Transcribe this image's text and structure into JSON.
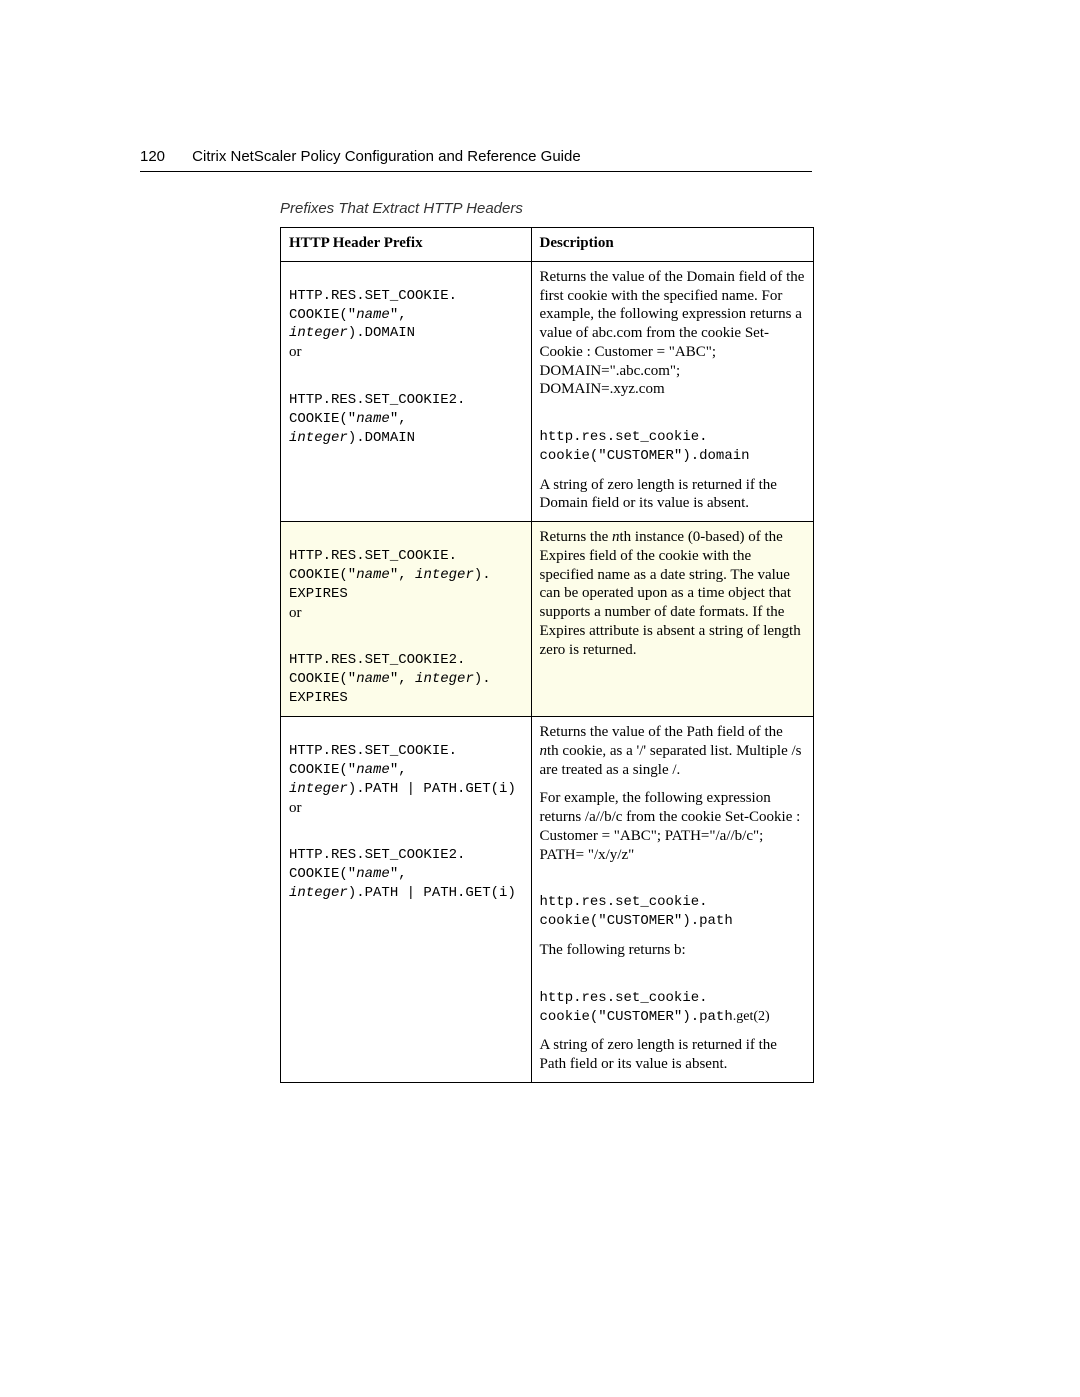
{
  "header": {
    "page_number": "120",
    "title": "Citrix NetScaler Policy Configuration and Reference Guide"
  },
  "table": {
    "caption": "Prefixes That Extract HTTP Headers",
    "headers": {
      "col1": "HTTP Header Prefix",
      "col2": "Description"
    },
    "rows": [
      {
        "prefix": {
          "l1a": "HTTP.RES.SET_COOKIE.",
          "l1b_pre": "COOKIE(\"",
          "l1b_arg1": "name",
          "l1b_mid": "\", ",
          "l1b_arg2": "integer",
          "l1b_post": ").DOMAIN",
          "or": "or",
          "l2a": "HTTP.RES.SET_COOKIE2.",
          "l2b_pre": "COOKIE(\"",
          "l2b_arg1": "name",
          "l2b_mid": "\", ",
          "l2b_arg2": "integer",
          "l2b_post": ").DOMAIN"
        },
        "desc": {
          "p1": "Returns the value of the Domain field of the first cookie with the specified name. For example, the following expression returns a value of abc.com from the cookie Set-Cookie : Customer = \"ABC\"; DOMAIN=\".abc.com\"; DOMAIN=.xyz.com",
          "code1a": "http.res.set_cookie.",
          "code1b": "cookie(\"CUSTOMER\").domain",
          "p2": "A string of zero length is returned if the Domain field or its value is absent."
        }
      },
      {
        "prefix": {
          "l1a": "HTTP.RES.SET_COOKIE.",
          "l1b_pre": "COOKIE(\"",
          "l1b_arg1": "name",
          "l1b_mid": "\", ",
          "l1b_arg2": "integer",
          "l1b_post": ").",
          "l1c": "EXPIRES",
          "or": "or",
          "l2a": "HTTP.RES.SET_COOKIE2.",
          "l2b_pre": "COOKIE(\"",
          "l2b_arg1": "name",
          "l2b_mid": "\", ",
          "l2b_arg2": "integer",
          "l2b_post": ").",
          "l2c": "EXPIRES"
        },
        "desc": {
          "p1_pre": "Returns the ",
          "p1_n": "n",
          "p1_post": "th instance (0-based) of the Expires field of the cookie with the specified name as a date string. The value can be operated upon as a time object that supports a number of date formats. If the Expires attribute is absent a string of length zero is returned."
        }
      },
      {
        "prefix": {
          "l1a": "HTTP.RES.SET_COOKIE.",
          "l1b_pre": "COOKIE(\"",
          "l1b_arg1": "name",
          "l1b_mid": "\", ",
          "l1b_arg2": "integer",
          "l1b_post": ").PATH | PATH.GET(i)",
          "or": "or",
          "l2a": "HTTP.RES.SET_COOKIE2.",
          "l2b_pre": "COOKIE(\"",
          "l2b_arg1": "name",
          "l2b_mid": "\", ",
          "l2b_arg2": "integer",
          "l2b_post": ").PATH | PATH.GET(i)"
        },
        "desc": {
          "p1_pre": "Returns the value of the Path field of the ",
          "p1_n": "n",
          "p1_post": "th cookie, as a '/' separated list. Multiple /s are treated as a single /.",
          "p2": "For example, the following expression returns /a//b/c from the cookie Set-Cookie : Customer = \"ABC\"; PATH=\"/a//b/c\"; PATH= \"/x/y/z\"",
          "code1a": "http.res.set_cookie.",
          "code1b": "cookie(\"CUSTOMER\").path",
          "p3": "The following returns b:",
          "code2a": "http.res.set_cookie.",
          "code2b_pre": "cookie(\"CUSTOMER\").path",
          "code2b_post": ".get(2)",
          "p4": "A string of zero length is returned if the Path field or its value is absent."
        }
      }
    ]
  }
}
